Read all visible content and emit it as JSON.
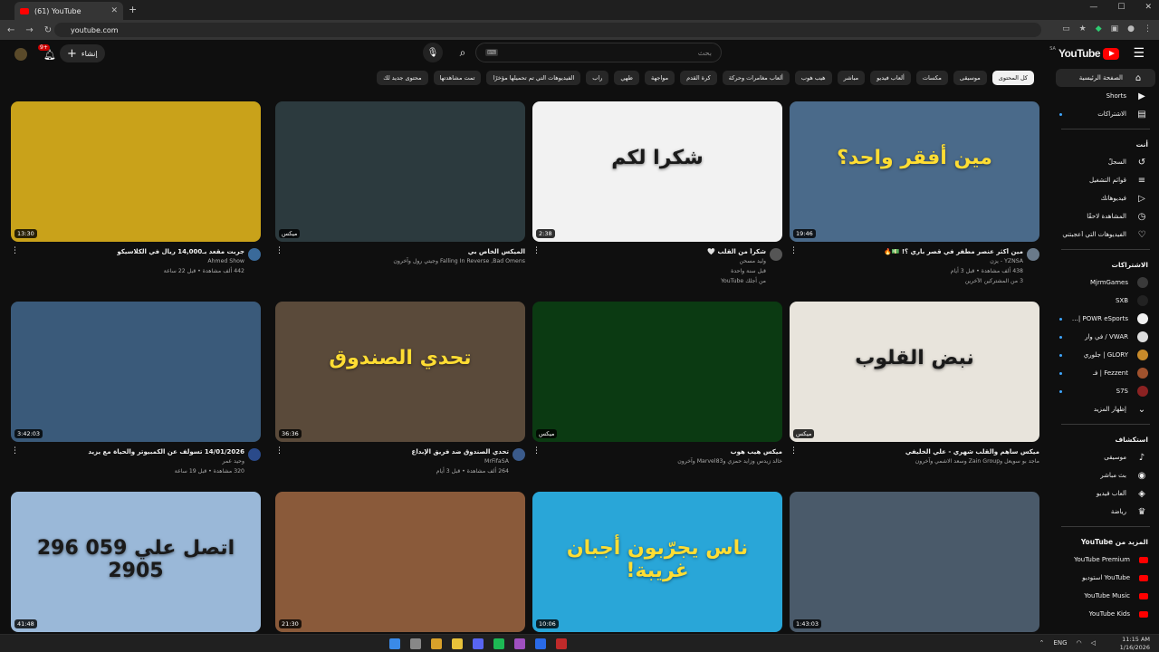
{
  "browser": {
    "tab_title": "(61) YouTube",
    "url": "youtube.com"
  },
  "masthead": {
    "search_placeholder": "بحث",
    "create_label": "إنشاء",
    "notification_count": "9+",
    "logo_text": "YouTube",
    "logo_country": "SA"
  },
  "chips": [
    {
      "label": "كل المحتوى",
      "active": true
    },
    {
      "label": "موسيقى",
      "active": false
    },
    {
      "label": "مكسات",
      "active": false
    },
    {
      "label": "ألعاب فيديو",
      "active": false
    },
    {
      "label": "مباشر",
      "active": false
    },
    {
      "label": "هيب هوب",
      "active": false
    },
    {
      "label": "ألعاب مغامرات وحركة",
      "active": false
    },
    {
      "label": "كرة القدم",
      "active": false
    },
    {
      "label": "مواجهة",
      "active": false
    },
    {
      "label": "طهي",
      "active": false
    },
    {
      "label": "راب",
      "active": false
    },
    {
      "label": "الفيديوهات التي تم تحميلها مؤخرًا",
      "active": false
    },
    {
      "label": "تمت مشاهدتها",
      "active": false
    },
    {
      "label": "محتوى جديد لك",
      "active": false
    }
  ],
  "sidebar": {
    "main": [
      {
        "label": "الصفحة الرئيسية",
        "icon": "home-icon"
      },
      {
        "label": "Shorts",
        "icon": "shorts-icon"
      },
      {
        "label": "الاشتراكات",
        "icon": "subscriptions-icon"
      }
    ],
    "you_header": "أنت",
    "you": [
      {
        "label": "السجلّ",
        "icon": "history-icon"
      },
      {
        "label": "قوائم التشغيل",
        "icon": "playlist-icon"
      },
      {
        "label": "فيديوهاتك",
        "icon": "your-videos-icon"
      },
      {
        "label": "المشاهدة لاحقًا",
        "icon": "watch-later-icon"
      },
      {
        "label": "الفيديوهات التي أعجبتني",
        "icon": "liked-icon"
      }
    ],
    "subs_header": "الاشتراكات",
    "subs": [
      {
        "label": "MjrmGames",
        "color": "#3a3a3a"
      },
      {
        "label": "SXB",
        "color": "#222222"
      },
      {
        "label": "POWR eSports | ...",
        "color": "#f1f1f1"
      },
      {
        "label": "VWAR / في وار",
        "color": "#dddddd"
      },
      {
        "label": "GLORY | جلوري",
        "color": "#c88a2a"
      },
      {
        "label": "Fezzent | فـ",
        "color": "#a0522d"
      },
      {
        "label": "S7S",
        "color": "#8b2222"
      }
    ],
    "show_more": "إظهار المزيد",
    "explore_header": "استكشاف",
    "explore": [
      {
        "label": "موسيقى",
        "icon": "music-icon"
      },
      {
        "label": "بث مباشر",
        "icon": "live-icon"
      },
      {
        "label": "ألعاب فيديو",
        "icon": "gaming-icon"
      },
      {
        "label": "رياضة",
        "icon": "trophy-icon"
      }
    ],
    "more_header": "المزيد من YouTube",
    "more": [
      {
        "label": "YouTube Premium"
      },
      {
        "label": "YouTube استوديو"
      },
      {
        "label": "YouTube Music"
      },
      {
        "label": "YouTube Kids"
      }
    ]
  },
  "videos": [
    {
      "title": "مين أكثر عنصر مطفر في قصر باري ؟! 💵🔥",
      "channel": "YZNSA - يزن",
      "stats": "438 ألف مشاهدة • قبل 3 أيام",
      "extra": "3 من المشتركين الآخرين",
      "duration": "19:46",
      "bg": "#4a6a8a",
      "overlay": "مين أفقر واحد؟",
      "avatar": "#6a7a8a"
    },
    {
      "title": "شكراً من القلب 🤍",
      "channel": "وليد مسحن",
      "stats": "قبل سنة واحدة",
      "extra": "من أجلك YouTube",
      "duration": "2:38",
      "bg": "#f2f2f2",
      "overlay": "شكرا لكم",
      "avatar": "#555555"
    },
    {
      "title": "الميكس الخاص بي",
      "channel": "Falling In Reverse ,Bad Omens وجيتي رول وآخرون",
      "stats": "",
      "extra": "",
      "duration": "ميكس",
      "bg": "#2c3a3e",
      "overlay": "",
      "avatar": ""
    },
    {
      "title": "جربت مقعد بـ14,000 ريال في الكلاسيكو",
      "channel": "Ahmed Show",
      "stats": "442 ألف مشاهدة • قبل 22 ساعة",
      "extra": "",
      "duration": "13:30",
      "bg": "#c9a21a",
      "overlay": "",
      "avatar": "#3a6a9a"
    },
    {
      "title": "ميكس ساهم والقلب شهري - علي الخليفي",
      "channel": "ماجد بو سويعل وZain Group وسعد الاشمي وآخرون",
      "stats": "",
      "extra": "",
      "duration": "ميكس",
      "bg": "#e8e4dc",
      "overlay": "نبض القلوب",
      "avatar": ""
    },
    {
      "title": "ميكس هيب هوب",
      "channel": "خالد زيدس وزايد حمزي وMarvel83 وآخرون",
      "stats": "",
      "extra": "",
      "duration": "ميكس",
      "bg": "#0b3a12",
      "overlay": "",
      "avatar": ""
    },
    {
      "title": "تحدي الصندوق ضد فريق الإبداع",
      "channel": "MrFifaSA",
      "stats": "264 ألف مشاهدة • قبل 3 أيام",
      "extra": "",
      "duration": "36:36",
      "bg": "#5a4a3a",
      "overlay": "تحدي الصندوق",
      "avatar": "#3a5a8a"
    },
    {
      "title": "14/01/2026 تسولف عن الكمبيوتر والحياة مع يزيد",
      "channel": "وحيد عمر",
      "stats": "320 مشاهدة • قبل 19 ساعة",
      "extra": "",
      "duration": "3:42:03",
      "bg": "#3a5a7a",
      "overlay": "",
      "avatar": "#2a4a8a"
    },
    {
      "title": "",
      "channel": "",
      "stats": "",
      "extra": "",
      "duration": "1:43:03",
      "bg": "#4a5a6a",
      "overlay": "",
      "avatar": ""
    },
    {
      "title": "",
      "channel": "",
      "stats": "",
      "extra": "",
      "duration": "10:06",
      "bg": "#29a6d8",
      "overlay": "ناس يجرّبون أجبان غريبة!",
      "avatar": ""
    },
    {
      "title": "",
      "channel": "",
      "stats": "",
      "extra": "",
      "duration": "21:30",
      "bg": "#8a5a3a",
      "overlay": "",
      "avatar": ""
    },
    {
      "title": "",
      "channel": "",
      "stats": "",
      "extra": "",
      "duration": "41:48",
      "bg": "#9ab8d8",
      "overlay": "اتصل علي 059 296 2905",
      "avatar": ""
    }
  ],
  "taskbar": {
    "lang": "ENG",
    "time": "11:15 AM",
    "date": "1/16/2026"
  }
}
